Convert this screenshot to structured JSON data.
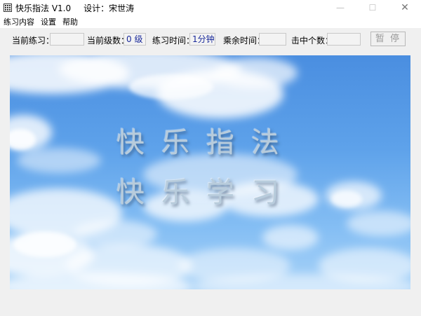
{
  "window": {
    "title": "快乐指法 V1.0",
    "author": "设计：宋世涛",
    "minimize": "—",
    "maximize": "☐",
    "close": "✕"
  },
  "menu": [
    "练习内容",
    "设置",
    "帮助"
  ],
  "toolbar": {
    "current_practice_label": "当前练习：",
    "current_practice_value": "",
    "current_level_label": "当前级数：",
    "current_level_value": "0 级",
    "practice_time_label": "练习时间：",
    "practice_time_value": "1分钟",
    "remaining_time_label": "乘余时间：",
    "remaining_time_value": "",
    "hits_label": "击中个数：",
    "hits_value": "",
    "pause_button": "暂 停"
  },
  "stage": {
    "line1": "快乐指法",
    "line2": "快乐学习"
  }
}
